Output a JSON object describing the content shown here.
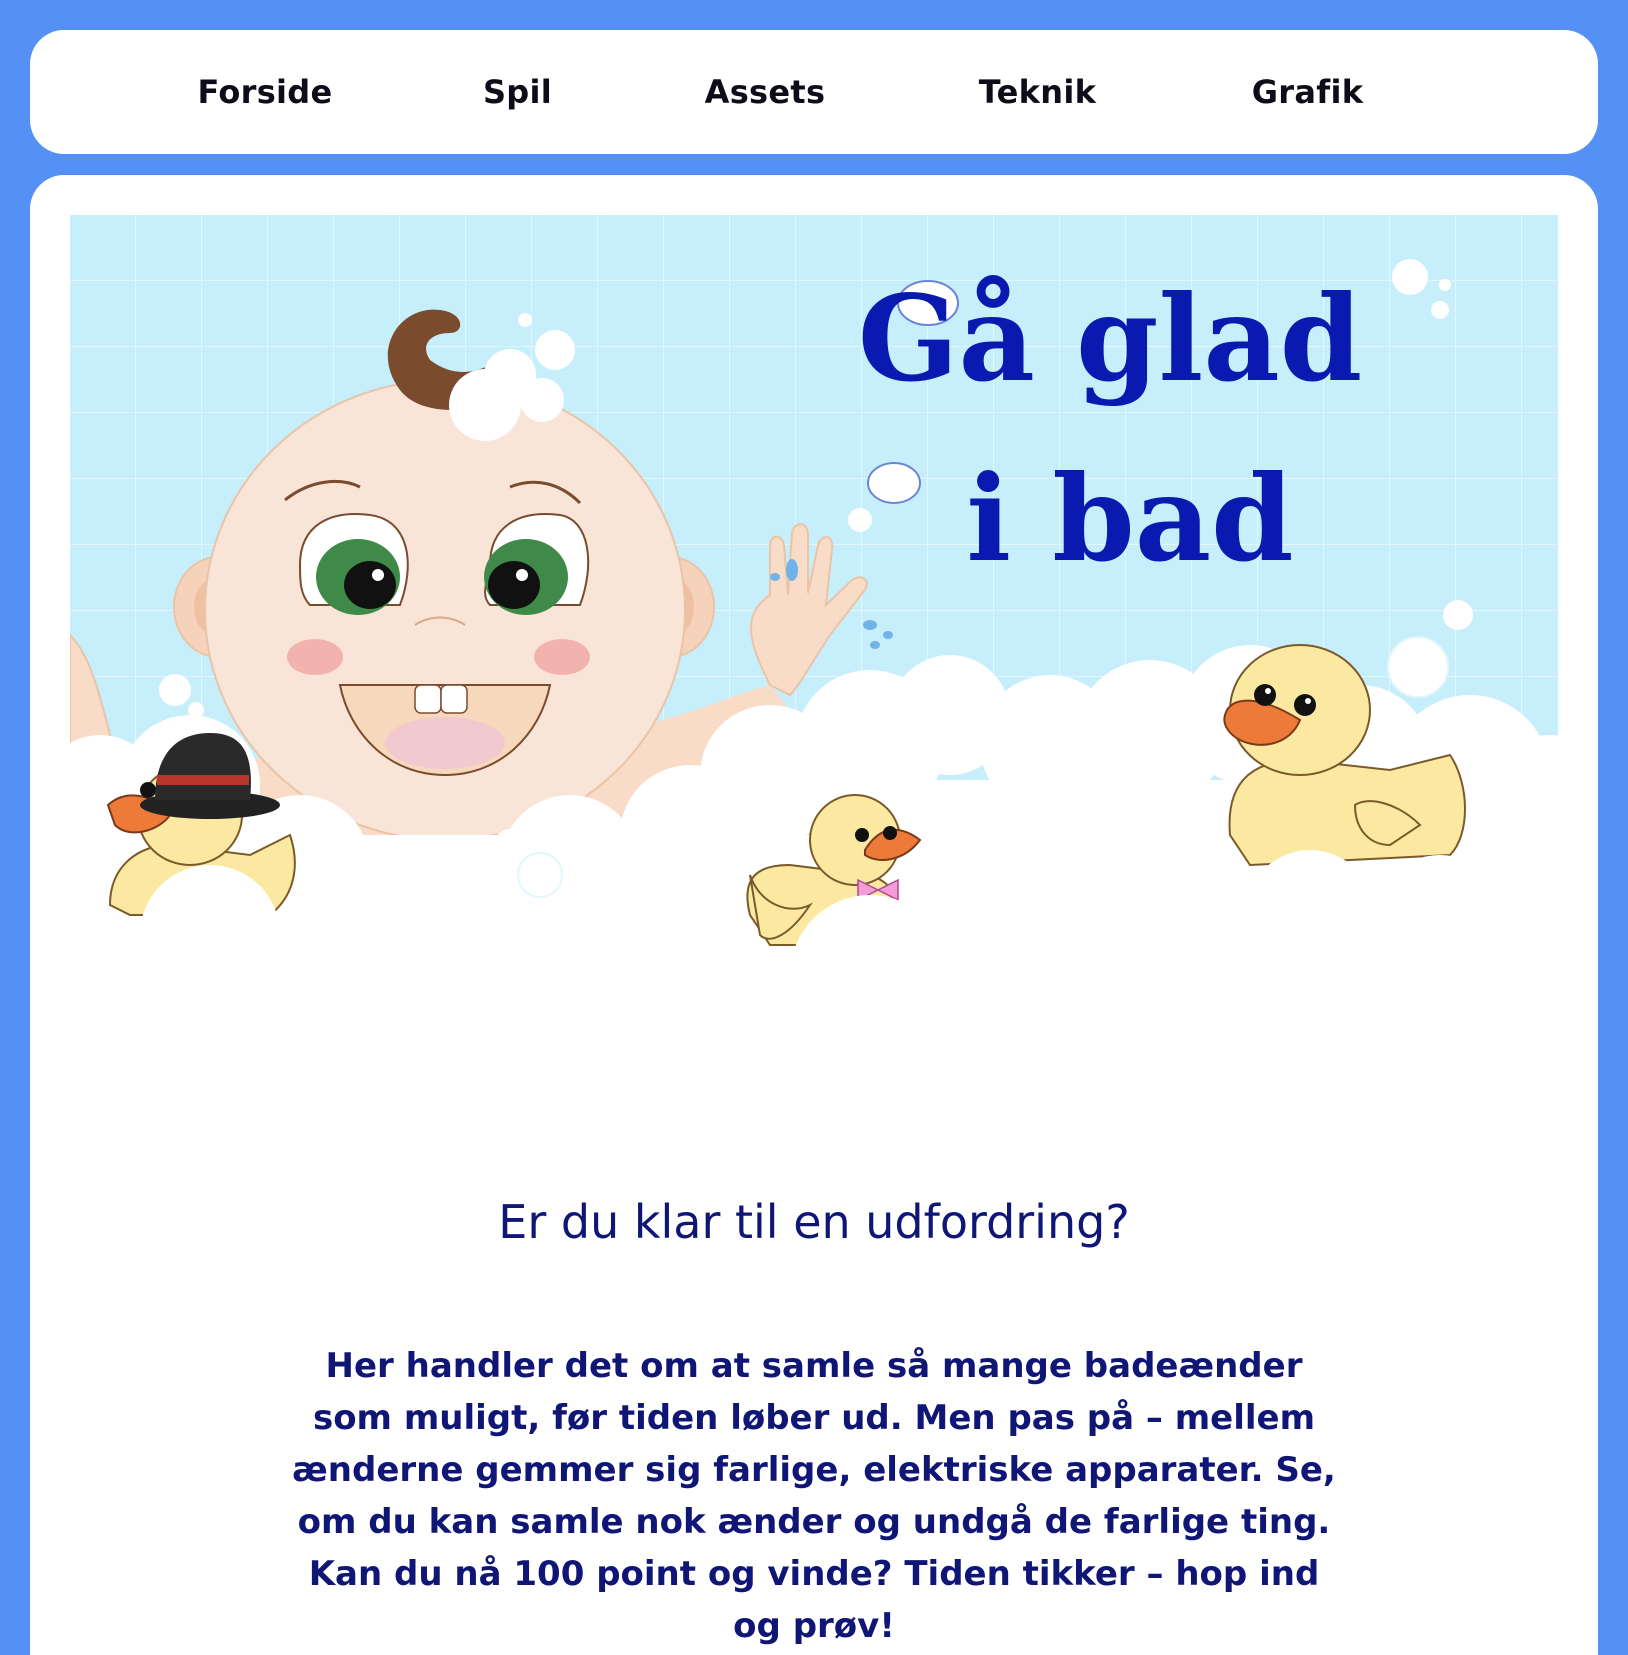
{
  "nav": {
    "items": [
      {
        "label": "Forside"
      },
      {
        "label": "Spil"
      },
      {
        "label": "Assets"
      },
      {
        "label": "Teknik"
      },
      {
        "label": "Grafik"
      }
    ]
  },
  "hero": {
    "title_line1": "Gå glad",
    "title_line2": "i bad"
  },
  "main": {
    "subtitle": "Er du klar til en udfordring?",
    "description": "Her handler det om at samle så mange badeænder som muligt, før tiden løber ud. Men pas på – mellem ænderne gemmer sig farlige, elektriske apparater. Se, om du kan samle nok ænder og undgå de farlige ting. Kan du nå 100 point og vinde? Tiden tikker – hop ind og prøv!"
  },
  "colors": {
    "page_background": "#5590f5",
    "text_dark_blue": "#0f1676",
    "title_blue": "#0a1ab0",
    "tile_background": "#c6eefb",
    "duck_yellow": "#fbe9a1",
    "beak_orange": "#ee7a3a"
  }
}
